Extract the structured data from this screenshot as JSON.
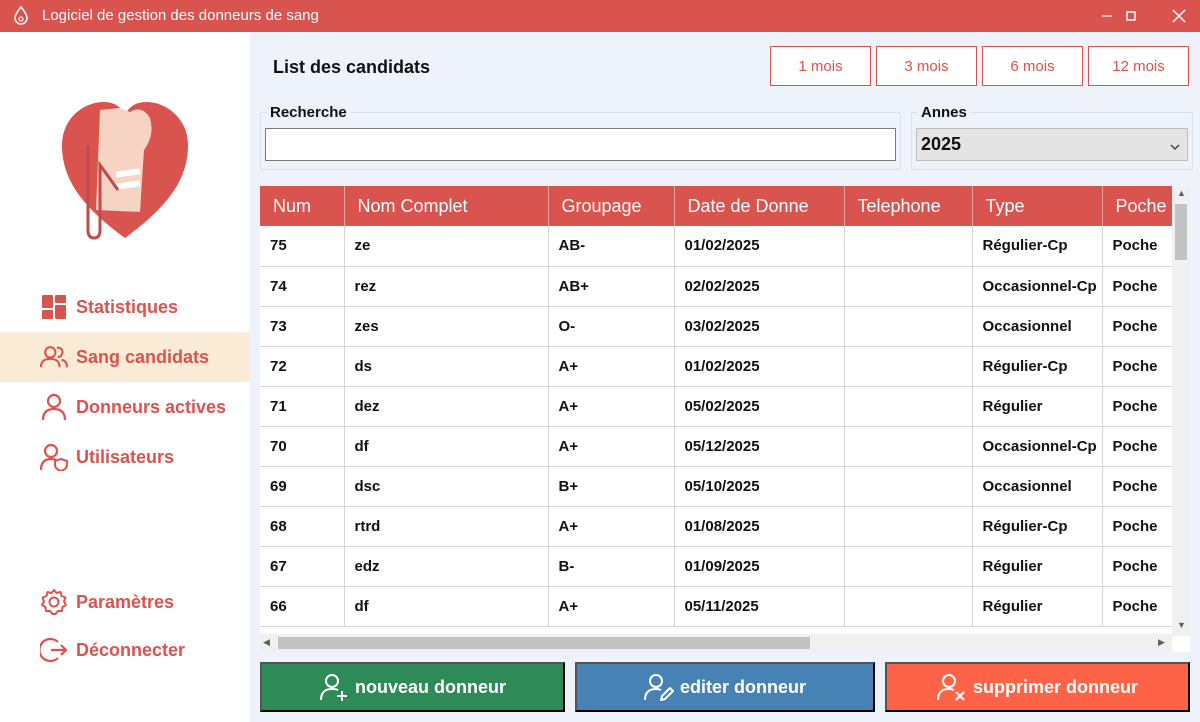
{
  "window": {
    "title": "Logiciel de gestion des donneurs de sang"
  },
  "sidebar": {
    "items": [
      {
        "label": "Statistiques",
        "icon": "dashboard-icon",
        "active": false
      },
      {
        "label": "Sang candidats",
        "icon": "users-icon",
        "active": true
      },
      {
        "label": "Donneurs actives",
        "icon": "user-icon",
        "active": false
      },
      {
        "label": "Utilisateurs",
        "icon": "user-shield-icon",
        "active": false
      }
    ],
    "bottom_items": [
      {
        "label": "Paramètres",
        "icon": "gear-icon"
      },
      {
        "label": "Déconnecter",
        "icon": "logout-icon"
      }
    ]
  },
  "main": {
    "title": "List des candidats",
    "period_buttons": [
      "1 mois",
      "3 mois",
      "6 mois",
      "12 mois"
    ],
    "search": {
      "label": "Recherche",
      "value": "",
      "placeholder": ""
    },
    "year": {
      "label": "Annes",
      "selected": "2025"
    }
  },
  "table": {
    "columns": [
      "Num",
      "Nom Complet",
      "Groupage",
      "Date de Donne",
      "Telephone",
      "Type",
      "Poche"
    ],
    "rows": [
      [
        "75",
        "ze",
        "AB-",
        "01/02/2025",
        "",
        "Régulier-Cp",
        "Poche"
      ],
      [
        "74",
        "rez",
        "AB+",
        "02/02/2025",
        "",
        "Occasionnel-Cp",
        "Poche"
      ],
      [
        "73",
        "zes",
        "O-",
        "03/02/2025",
        "",
        "Occasionnel",
        "Poche"
      ],
      [
        "72",
        "ds",
        "A+",
        "01/02/2025",
        "",
        "Régulier-Cp",
        "Poche"
      ],
      [
        "71",
        "dez",
        "A+",
        "05/02/2025",
        "",
        "Régulier",
        "Poche"
      ],
      [
        "70",
        "df",
        "A+",
        "05/12/2025",
        "",
        "Occasionnel-Cp",
        "Poche"
      ],
      [
        "69",
        "dsc",
        "B+",
        "05/10/2025",
        "",
        "Occasionnel",
        "Poche"
      ],
      [
        "68",
        "rtrd",
        "A+",
        "01/08/2025",
        "",
        "Régulier-Cp",
        "Poche"
      ],
      [
        "67",
        "edz",
        "B-",
        "01/09/2025",
        "",
        "Régulier",
        "Poche"
      ],
      [
        "66",
        "df",
        "A+",
        "05/11/2025",
        "",
        "Régulier",
        "Poche"
      ]
    ]
  },
  "actions": {
    "new": "nouveau donneur",
    "edit": "editer donneur",
    "delete": "supprimer donneur"
  },
  "colors": {
    "accent": "#d9534f",
    "new_button": "#2e8b57",
    "edit_button": "#4682b4",
    "delete_button": "#ff6347",
    "active_nav": "#faebd7"
  }
}
